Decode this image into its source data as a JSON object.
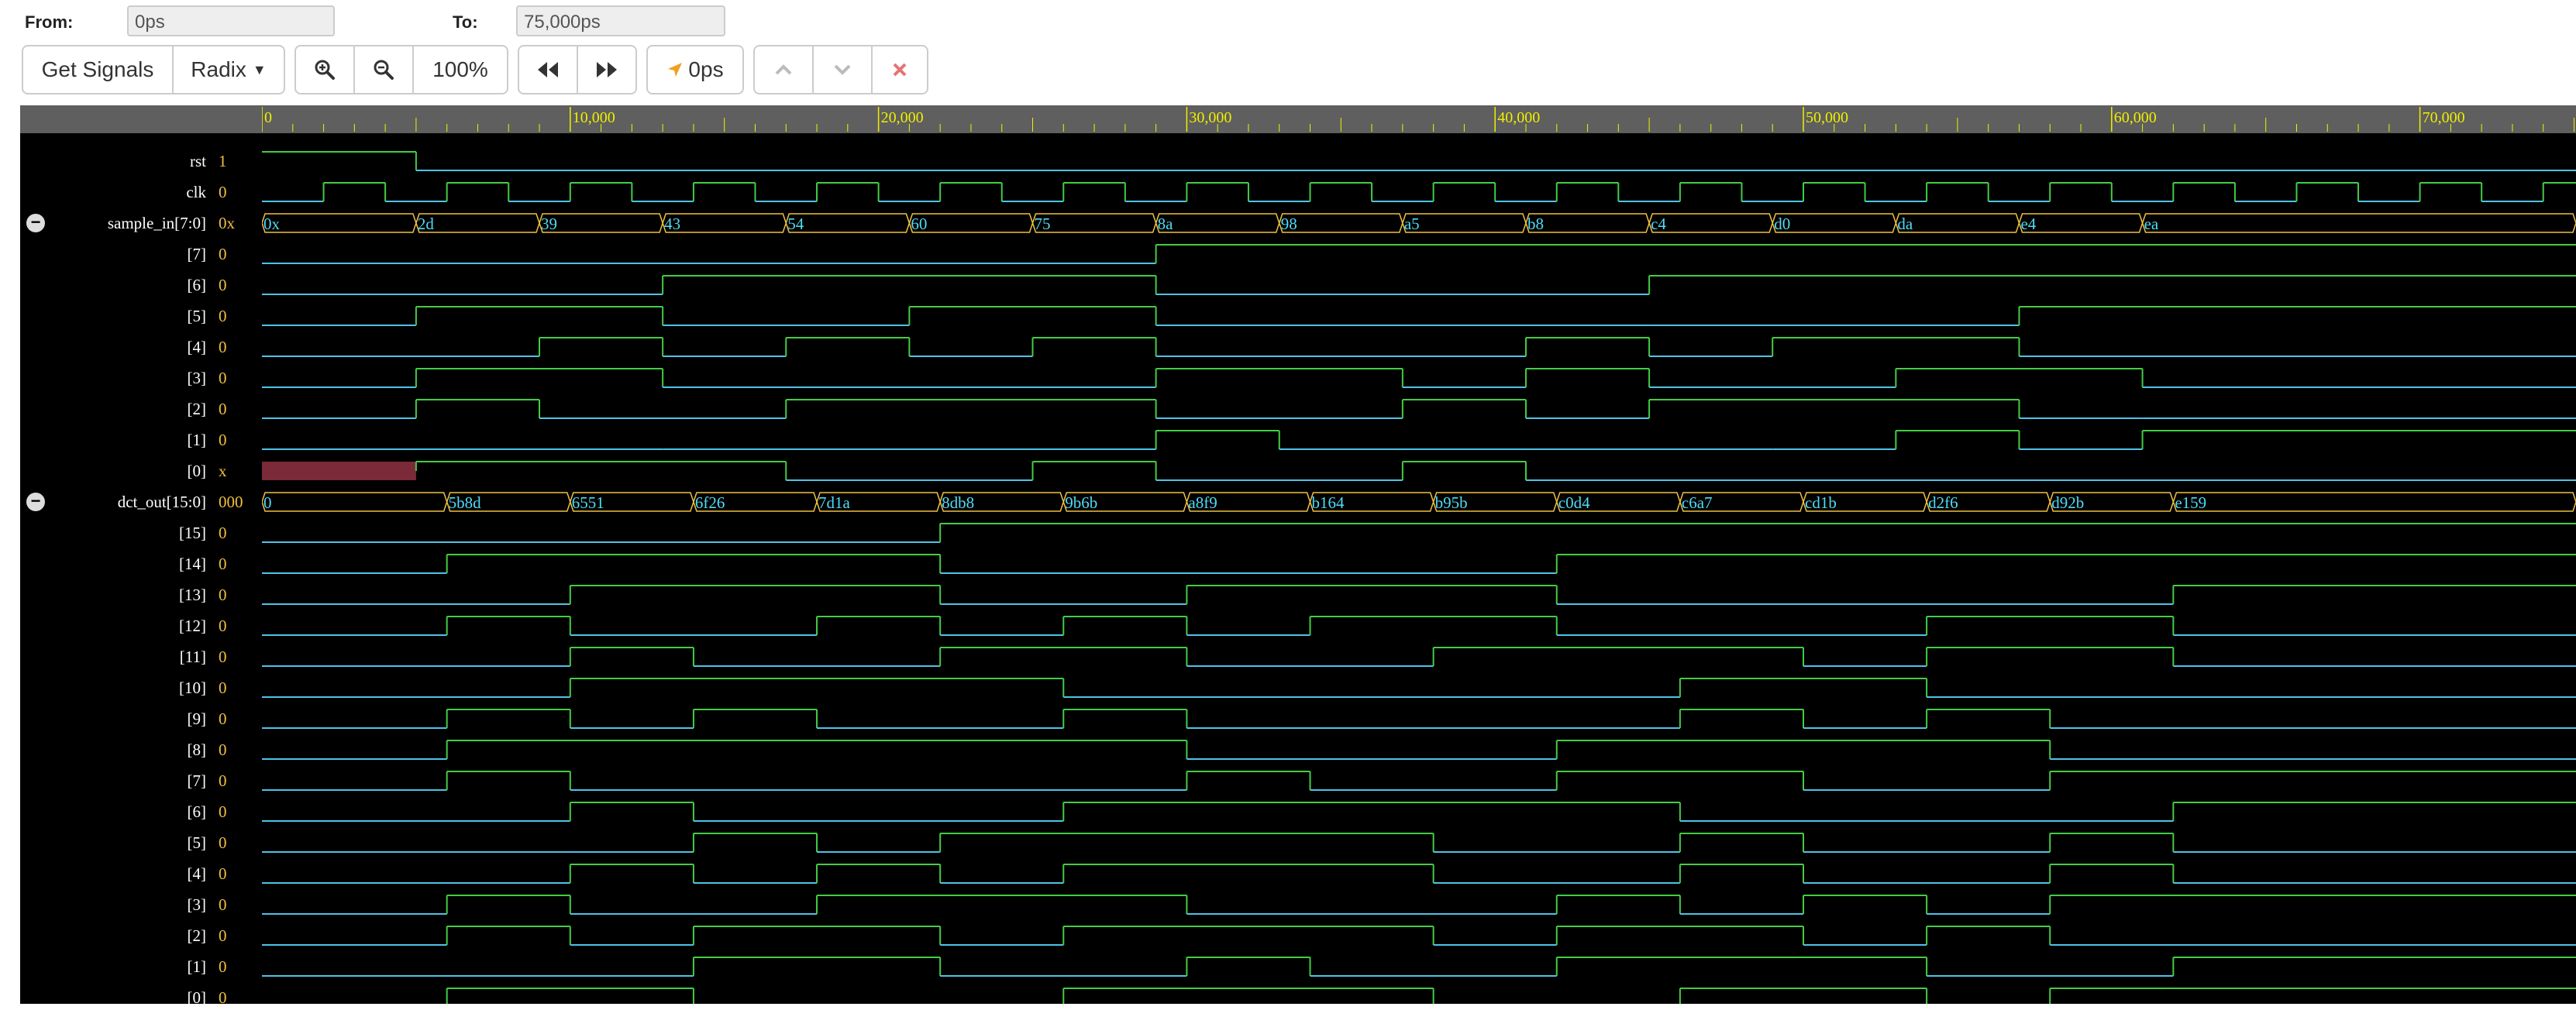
{
  "toolbar": {
    "from_label": "From:",
    "from_value": "0ps",
    "to_label": "To:",
    "to_value": "75,000ps",
    "get_signals": "Get Signals",
    "radix": "Radix",
    "zoom_level": "100%",
    "cursor_time": "0ps"
  },
  "icons": {
    "zoom_in": "zoom-in-icon",
    "zoom_out": "zoom-out-icon",
    "prev": "fast-backward-icon",
    "next": "fast-forward-icon",
    "cursor": "location-arrow-icon",
    "up": "chevron-up-icon",
    "down": "chevron-down-icon",
    "remove": "close-icon"
  },
  "colors": {
    "high": "#44cc44",
    "low": "#4fc3e8",
    "bus": "#f0c040",
    "bus_text": "#4fdcf8",
    "undefined": "#7a2a38",
    "ruler_text": "#f0f000"
  },
  "time": {
    "start": 0,
    "end": 75000,
    "unit": "ps",
    "ticks": [
      "0",
      "10,000",
      "20,000",
      "30,000",
      "40,000",
      "50,000",
      "60,000",
      "70,000"
    ]
  },
  "signals": [
    {
      "name": "rst",
      "value": "1",
      "type": "bit",
      "transitions": [
        [
          0,
          1
        ],
        [
          5000,
          0
        ]
      ]
    },
    {
      "name": "clk",
      "value": "0",
      "type": "clock",
      "period": 4000
    },
    {
      "name": "sample_in[7:0]",
      "value": "0x",
      "type": "bus",
      "collapsible": true,
      "transitions": [
        [
          0,
          "0x"
        ],
        [
          5000,
          "2d"
        ],
        [
          9000,
          "39"
        ],
        [
          13000,
          "43"
        ],
        [
          17000,
          "54"
        ],
        [
          21000,
          "60"
        ],
        [
          25000,
          "75"
        ],
        [
          29000,
          "8a"
        ],
        [
          33000,
          "98"
        ],
        [
          37000,
          "a5"
        ],
        [
          41000,
          "b8"
        ],
        [
          45000,
          "c4"
        ],
        [
          49000,
          "d0"
        ],
        [
          53000,
          "da"
        ],
        [
          57000,
          "e4"
        ],
        [
          61000,
          "ea"
        ]
      ]
    },
    {
      "name": "[7]",
      "value": "0",
      "type": "bit",
      "transitions": [
        [
          0,
          0
        ],
        [
          29000,
          1
        ]
      ]
    },
    {
      "name": "[6]",
      "value": "0",
      "type": "bit",
      "transitions": [
        [
          0,
          0
        ],
        [
          13000,
          1
        ],
        [
          29000,
          0
        ],
        [
          45000,
          1
        ]
      ]
    },
    {
      "name": "[5]",
      "value": "0",
      "type": "bit",
      "transitions": [
        [
          0,
          0
        ],
        [
          5000,
          1
        ],
        [
          13000,
          0
        ],
        [
          21000,
          1
        ],
        [
          29000,
          0
        ],
        [
          45000,
          0
        ],
        [
          57000,
          1
        ]
      ]
    },
    {
      "name": "[4]",
      "value": "0",
      "type": "bit",
      "transitions": [
        [
          0,
          0
        ],
        [
          9000,
          1
        ],
        [
          13000,
          0
        ],
        [
          17000,
          1
        ],
        [
          21000,
          0
        ],
        [
          25000,
          1
        ],
        [
          29000,
          0
        ],
        [
          41000,
          1
        ],
        [
          45000,
          0
        ],
        [
          49000,
          1
        ],
        [
          57000,
          0
        ]
      ]
    },
    {
      "name": "[3]",
      "value": "0",
      "type": "bit",
      "transitions": [
        [
          0,
          0
        ],
        [
          5000,
          1
        ],
        [
          13000,
          0
        ],
        [
          29000,
          1
        ],
        [
          37000,
          0
        ],
        [
          41000,
          1
        ],
        [
          45000,
          0
        ],
        [
          53000,
          1
        ],
        [
          61000,
          0
        ]
      ]
    },
    {
      "name": "[2]",
      "value": "0",
      "type": "bit",
      "transitions": [
        [
          0,
          0
        ],
        [
          5000,
          1
        ],
        [
          9000,
          0
        ],
        [
          17000,
          1
        ],
        [
          29000,
          0
        ],
        [
          37000,
          1
        ],
        [
          41000,
          0
        ],
        [
          45000,
          1
        ],
        [
          57000,
          0
        ],
        [
          61000,
          0
        ]
      ]
    },
    {
      "name": "[1]",
      "value": "0",
      "type": "bit",
      "transitions": [
        [
          0,
          0
        ],
        [
          13000,
          0
        ],
        [
          29000,
          1
        ],
        [
          33000,
          0
        ],
        [
          49000,
          0
        ],
        [
          53000,
          1
        ],
        [
          57000,
          0
        ],
        [
          61000,
          1
        ]
      ]
    },
    {
      "name": "[0]",
      "value": "x",
      "type": "bit",
      "transitions": [
        [
          0,
          "x"
        ],
        [
          5000,
          1
        ],
        [
          17000,
          0
        ],
        [
          25000,
          1
        ],
        [
          29000,
          0
        ],
        [
          37000,
          1
        ],
        [
          41000,
          0
        ]
      ]
    },
    {
      "name": "dct_out[15:0]",
      "value": "000",
      "type": "bus",
      "collapsible": true,
      "transitions": [
        [
          0,
          "0"
        ],
        [
          6000,
          "5b8d"
        ],
        [
          10000,
          "6551"
        ],
        [
          14000,
          "6f26"
        ],
        [
          18000,
          "7d1a"
        ],
        [
          22000,
          "8db8"
        ],
        [
          26000,
          "9b6b"
        ],
        [
          30000,
          "a8f9"
        ],
        [
          34000,
          "b164"
        ],
        [
          38000,
          "b95b"
        ],
        [
          42000,
          "c0d4"
        ],
        [
          46000,
          "c6a7"
        ],
        [
          50000,
          "cd1b"
        ],
        [
          54000,
          "d2f6"
        ],
        [
          58000,
          "d92b"
        ],
        [
          62000,
          "e159"
        ]
      ]
    },
    {
      "name": "[15]",
      "value": "0",
      "type": "bit",
      "transitions": [
        [
          0,
          0
        ],
        [
          22000,
          1
        ]
      ]
    },
    {
      "name": "[14]",
      "value": "0",
      "type": "bit",
      "transitions": [
        [
          0,
          0
        ],
        [
          6000,
          1
        ],
        [
          22000,
          0
        ],
        [
          42000,
          1
        ]
      ]
    },
    {
      "name": "[13]",
      "value": "0",
      "type": "bit",
      "transitions": [
        [
          0,
          0
        ],
        [
          10000,
          1
        ],
        [
          22000,
          0
        ],
        [
          30000,
          1
        ],
        [
          42000,
          0
        ],
        [
          62000,
          1
        ]
      ]
    },
    {
      "name": "[12]",
      "value": "0",
      "type": "bit",
      "transitions": [
        [
          0,
          0
        ],
        [
          6000,
          1
        ],
        [
          10000,
          0
        ],
        [
          18000,
          1
        ],
        [
          22000,
          0
        ],
        [
          26000,
          1
        ],
        [
          30000,
          0
        ],
        [
          34000,
          1
        ],
        [
          42000,
          0
        ],
        [
          54000,
          1
        ],
        [
          62000,
          0
        ]
      ]
    },
    {
      "name": "[11]",
      "value": "0",
      "type": "bit",
      "transitions": [
        [
          0,
          0
        ],
        [
          10000,
          1
        ],
        [
          14000,
          0
        ],
        [
          22000,
          1
        ],
        [
          30000,
          0
        ],
        [
          38000,
          1
        ],
        [
          50000,
          0
        ],
        [
          54000,
          1
        ],
        [
          62000,
          0
        ]
      ]
    },
    {
      "name": "[10]",
      "value": "0",
      "type": "bit",
      "transitions": [
        [
          0,
          0
        ],
        [
          10000,
          1
        ],
        [
          26000,
          0
        ],
        [
          46000,
          1
        ],
        [
          54000,
          0
        ]
      ]
    },
    {
      "name": "[9]",
      "value": "0",
      "type": "bit",
      "transitions": [
        [
          0,
          0
        ],
        [
          6000,
          1
        ],
        [
          10000,
          0
        ],
        [
          14000,
          1
        ],
        [
          18000,
          0
        ],
        [
          26000,
          1
        ],
        [
          30000,
          0
        ],
        [
          46000,
          1
        ],
        [
          50000,
          0
        ],
        [
          54000,
          1
        ],
        [
          58000,
          0
        ]
      ]
    },
    {
      "name": "[8]",
      "value": "0",
      "type": "bit",
      "transitions": [
        [
          0,
          0
        ],
        [
          6000,
          1
        ],
        [
          30000,
          0
        ],
        [
          42000,
          1
        ],
        [
          58000,
          0
        ]
      ]
    },
    {
      "name": "[7]",
      "value": "0",
      "type": "bit",
      "transitions": [
        [
          0,
          0
        ],
        [
          6000,
          1
        ],
        [
          10000,
          0
        ],
        [
          30000,
          1
        ],
        [
          34000,
          0
        ],
        [
          42000,
          1
        ],
        [
          50000,
          0
        ],
        [
          58000,
          1
        ]
      ]
    },
    {
      "name": "[6]",
      "value": "0",
      "type": "bit",
      "transitions": [
        [
          0,
          0
        ],
        [
          10000,
          1
        ],
        [
          14000,
          0
        ],
        [
          26000,
          1
        ],
        [
          46000,
          0
        ],
        [
          62000,
          1
        ]
      ]
    },
    {
      "name": "[5]",
      "value": "0",
      "type": "bit",
      "transitions": [
        [
          0,
          0
        ],
        [
          14000,
          1
        ],
        [
          18000,
          0
        ],
        [
          22000,
          1
        ],
        [
          38000,
          0
        ],
        [
          46000,
          1
        ],
        [
          50000,
          0
        ],
        [
          58000,
          1
        ],
        [
          62000,
          0
        ]
      ]
    },
    {
      "name": "[4]",
      "value": "0",
      "type": "bit",
      "transitions": [
        [
          0,
          0
        ],
        [
          10000,
          1
        ],
        [
          14000,
          0
        ],
        [
          18000,
          1
        ],
        [
          22000,
          0
        ],
        [
          26000,
          1
        ],
        [
          38000,
          0
        ],
        [
          46000,
          1
        ],
        [
          50000,
          0
        ],
        [
          58000,
          1
        ],
        [
          62000,
          0
        ]
      ]
    },
    {
      "name": "[3]",
      "value": "0",
      "type": "bit",
      "transitions": [
        [
          0,
          0
        ],
        [
          6000,
          1
        ],
        [
          10000,
          0
        ],
        [
          18000,
          1
        ],
        [
          30000,
          0
        ],
        [
          42000,
          1
        ],
        [
          46000,
          0
        ],
        [
          50000,
          1
        ],
        [
          54000,
          0
        ],
        [
          58000,
          1
        ]
      ]
    },
    {
      "name": "[2]",
      "value": "0",
      "type": "bit",
      "transitions": [
        [
          0,
          0
        ],
        [
          6000,
          1
        ],
        [
          10000,
          0
        ],
        [
          14000,
          1
        ],
        [
          22000,
          0
        ],
        [
          26000,
          1
        ],
        [
          38000,
          0
        ],
        [
          42000,
          1
        ],
        [
          50000,
          0
        ],
        [
          54000,
          1
        ],
        [
          58000,
          0
        ]
      ]
    },
    {
      "name": "[1]",
      "value": "0",
      "type": "bit",
      "transitions": [
        [
          0,
          0
        ],
        [
          14000,
          1
        ],
        [
          22000,
          0
        ],
        [
          30000,
          1
        ],
        [
          34000,
          0
        ],
        [
          42000,
          1
        ],
        [
          54000,
          0
        ],
        [
          62000,
          1
        ]
      ]
    },
    {
      "name": "[0]",
      "value": "0",
      "type": "bit",
      "transitions": [
        [
          0,
          0
        ],
        [
          6000,
          1
        ],
        [
          14000,
          0
        ],
        [
          26000,
          1
        ],
        [
          38000,
          0
        ],
        [
          46000,
          1
        ],
        [
          54000,
          0
        ],
        [
          58000,
          1
        ]
      ]
    }
  ]
}
